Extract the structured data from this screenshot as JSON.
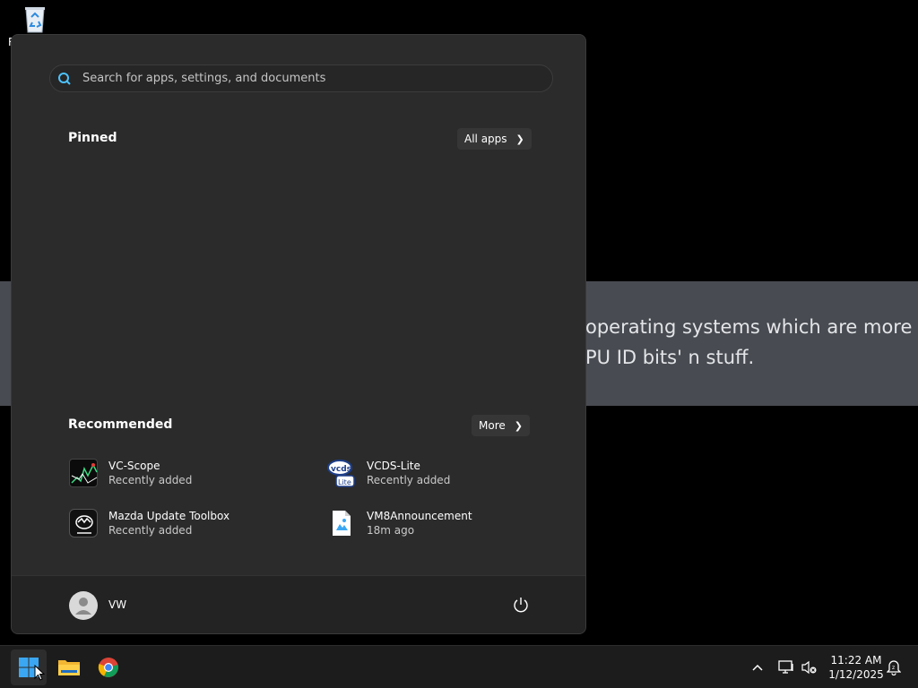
{
  "desktop": {
    "recycle_bin_label": "R",
    "background_window_text": "operating systems which are more\nPU ID bits' n stuff."
  },
  "start_menu": {
    "search": {
      "placeholder": "Search for apps, settings, and documents"
    },
    "pinned": {
      "title": "Pinned",
      "all_apps_label": "All apps"
    },
    "recommended": {
      "title": "Recommended",
      "more_label": "More",
      "items": [
        {
          "name": "VC-Scope",
          "subtitle": "Recently added",
          "icon": "vc-scope-icon"
        },
        {
          "name": "VCDS-Lite",
          "subtitle": "Recently added",
          "icon": "vcds-lite-icon"
        },
        {
          "name": "Mazda Update Toolbox",
          "subtitle": "Recently added",
          "icon": "mazda-icon"
        },
        {
          "name": "VM8Announcement",
          "subtitle": "18m ago",
          "icon": "image-file-icon"
        }
      ]
    },
    "user": {
      "name": "VW"
    }
  },
  "taskbar": {
    "clock": {
      "time": "11:22 AM",
      "date": "1/12/2025"
    }
  },
  "colors": {
    "menu_bg": "#2b2b2b",
    "taskbar_bg": "#1c1c1c",
    "accent_blue": "#3ba7f3",
    "search_icon": "#4cc2ff"
  }
}
